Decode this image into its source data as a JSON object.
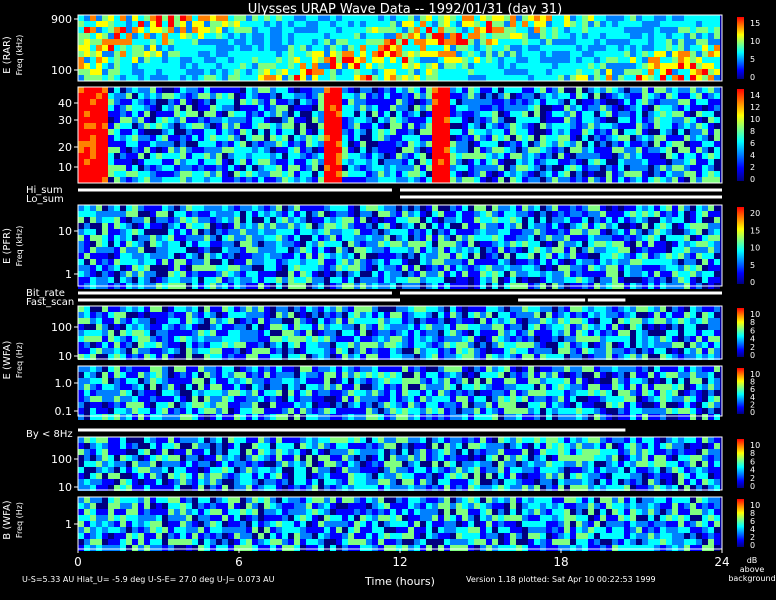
{
  "chart_data": {
    "type": "heatmap",
    "title": "Ulysses URAP Wave Data -- 1992/01/31  (day 31)",
    "xlabel": "Time (hours)",
    "xticks": [
      "0",
      "6",
      "12",
      "18",
      "24"
    ],
    "xlim": [
      0,
      24
    ],
    "footer": {
      "left": "U-S=5.33 AU  Hlat_U= -5.9 deg  U-S-E= 27.0 deg  U-J= 0.073 AU",
      "right": "Version 1.18 plotted: Sat Apr 10 00:22:53 1999"
    },
    "colorbar_units": [
      "dB",
      "above",
      "background"
    ],
    "colormap": [
      "#000080",
      "#0000ff",
      "#0080ff",
      "#00ffff",
      "#80ff80",
      "#ffff00",
      "#ff8000",
      "#ff0000"
    ],
    "panels": [
      {
        "id": "rar-low",
        "ytick_labels": [
          "900",
          "100"
        ],
        "log": true,
        "ylim": [
          50,
          1000
        ],
        "cb_labels": [
          "15",
          "10",
          "5",
          "0"
        ]
      },
      {
        "id": "rar-high",
        "ytick_labels": [
          "40",
          "30",
          "20",
          "10"
        ],
        "log": false,
        "ylim": [
          0,
          48
        ],
        "cb_labels": [
          "14",
          "12",
          "10",
          "8",
          "6",
          "4",
          "2",
          "0"
        ]
      },
      {
        "id": "pfr",
        "ytick_labels": [
          "10",
          "1"
        ],
        "log": true,
        "ylim": [
          0.5,
          25
        ],
        "cb_labels": [
          "20",
          "15",
          "10",
          "5",
          "0"
        ]
      },
      {
        "id": "wfa-e-low",
        "ytick_labels": [
          "100",
          "10"
        ],
        "log": true,
        "ylim": [
          8,
          400
        ],
        "cb_labels": [
          "10",
          "8",
          "6",
          "4",
          "2",
          "0"
        ]
      },
      {
        "id": "wfa-e-high",
        "ytick_labels": [
          "1.0",
          "0.1"
        ],
        "log": true,
        "ylim": [
          0.08,
          4
        ],
        "cb_labels": [
          "10",
          "8",
          "6",
          "4",
          "2",
          "0"
        ]
      },
      {
        "id": "wfa-b-low",
        "ytick_labels": [
          "100",
          "10"
        ],
        "log": true,
        "ylim": [
          8,
          400
        ],
        "cb_labels": [
          "10",
          "8",
          "6",
          "4",
          "2",
          "0"
        ]
      },
      {
        "id": "wfa-b-high",
        "ytick_labels": [
          "1"
        ],
        "log": true,
        "ylim": [
          0.08,
          4
        ],
        "cb_labels": [
          "10",
          "8",
          "6",
          "4",
          "2",
          "0"
        ]
      }
    ],
    "group_labels": [
      {
        "id": "rar",
        "text": "E (RAR)"
      },
      {
        "id": "freq-rar",
        "text": "Freq (kHz)"
      },
      {
        "id": "pfr",
        "text": "E (PFR)"
      },
      {
        "id": "freq-pfr",
        "text": "Freq (kHz)"
      },
      {
        "id": "wfa-e",
        "text": "E (WFA)"
      },
      {
        "id": "freq-wfa-e",
        "text": "Freq (Hz)"
      },
      {
        "id": "wfa-b",
        "text": "B (WFA)"
      },
      {
        "id": "freq-wfa-b",
        "text": "Freq (Hz)"
      }
    ],
    "flag_rows": [
      {
        "id": "hi-sum",
        "label": "Hi_sum",
        "segments": [
          [
            0,
            11.7
          ],
          [
            12.0,
            24
          ]
        ]
      },
      {
        "id": "lo-sum",
        "label": "Lo_sum",
        "segments": [
          [
            12.0,
            24
          ]
        ]
      },
      {
        "id": "bit-rate",
        "label": "Bit_rate",
        "segments": [
          [
            0,
            11.7
          ],
          [
            12.0,
            24
          ]
        ]
      },
      {
        "id": "fast-scan",
        "label": "Fast_scan",
        "segments": [
          [
            0,
            12.0
          ],
          [
            16.4,
            18.9
          ],
          [
            19.0,
            20.4
          ]
        ]
      },
      {
        "id": "by-lt-8hz",
        "label": "By < 8Hz",
        "segments": [
          [
            0,
            20.4
          ]
        ]
      }
    ]
  }
}
